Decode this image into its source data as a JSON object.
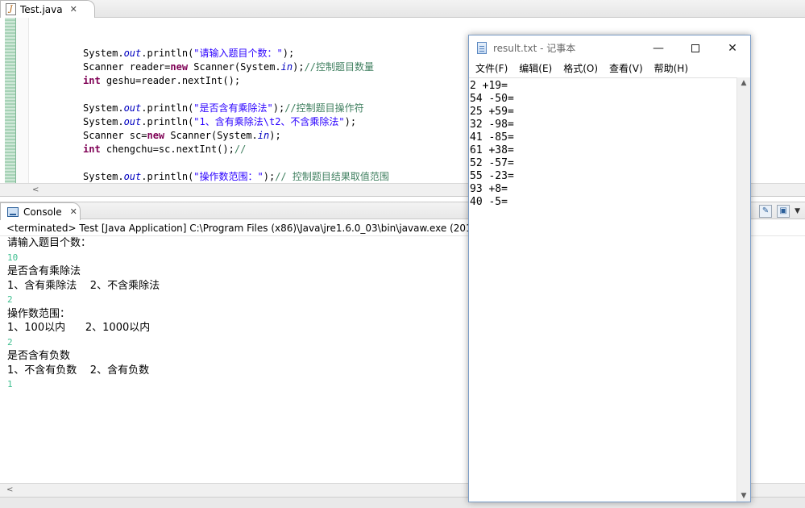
{
  "editor": {
    "tab_label": "Test.java",
    "code_lines": [
      {
        "pre": "System.",
        "field": "out",
        "mid": ".println(",
        "str": "\"请输入题目个数：\"",
        "post": ");",
        "comment": ""
      },
      {
        "pre": "Scanner reader=",
        "kw": "new",
        "post2": " Scanner(System.",
        "field2": "in",
        "post": ");",
        "comment": "//控制题目数量"
      },
      {
        "kwstart": "int",
        "rest": " geshu=reader.nextInt();"
      },
      {
        "blank": true
      },
      {
        "pre": "System.",
        "field": "out",
        "mid": ".println(",
        "str": "\"是否含有乘除法\"",
        "post": ");",
        "comment": "//控制题目操作符"
      },
      {
        "pre": "System.",
        "field": "out",
        "mid": ".println(",
        "str": "\"1、含有乘除法\\t2、不含乘除法\"",
        "post": ");",
        "comment": ""
      },
      {
        "pre": "Scanner sc=",
        "kw": "new",
        "post2": " Scanner(System.",
        "field2": "in",
        "post": ");",
        "comment": ""
      },
      {
        "kwstart": "int",
        "rest": " chengchu=sc.nextInt();",
        "comment": "//"
      },
      {
        "blank": true
      },
      {
        "pre": "System.",
        "field": "out",
        "mid": ".println(",
        "str": "\"操作数范围：\"",
        "post": ");",
        "comment": "// 控制题目结果取值范围"
      }
    ]
  },
  "console": {
    "tab_label": "Console",
    "status": "<terminated> Test [Java Application] C:\\Program Files (x86)\\Java\\jre1.6.0_03\\bin\\javaw.exe (2019-9",
    "lines": [
      {
        "text": "请输入题目个数：",
        "input": false
      },
      {
        "text": "10",
        "input": true
      },
      {
        "text": "是否含有乘除法",
        "input": false
      },
      {
        "text": "1、含有乘除法    2、不含乘除法",
        "input": false
      },
      {
        "text": "2",
        "input": true
      },
      {
        "text": "操作数范围：",
        "input": false
      },
      {
        "text": "1、100以内      2、1000以内",
        "input": false
      },
      {
        "text": "2",
        "input": true
      },
      {
        "text": "是否含有负数",
        "input": false
      },
      {
        "text": "1、不含有负数    2、含有负数",
        "input": false
      },
      {
        "text": "1",
        "input": true
      }
    ]
  },
  "notepad": {
    "title": "result.txt - 记事本",
    "menus": [
      "文件(F)",
      "编辑(E)",
      "格式(O)",
      "查看(V)",
      "帮助(H)"
    ],
    "lines": [
      "2 +19=",
      "54 -50=",
      "25 +59=",
      "32 -98=",
      "41 -85=",
      "61 +38=",
      "52 -57=",
      "55 -23=",
      "93 +8=",
      "40 -5="
    ]
  }
}
